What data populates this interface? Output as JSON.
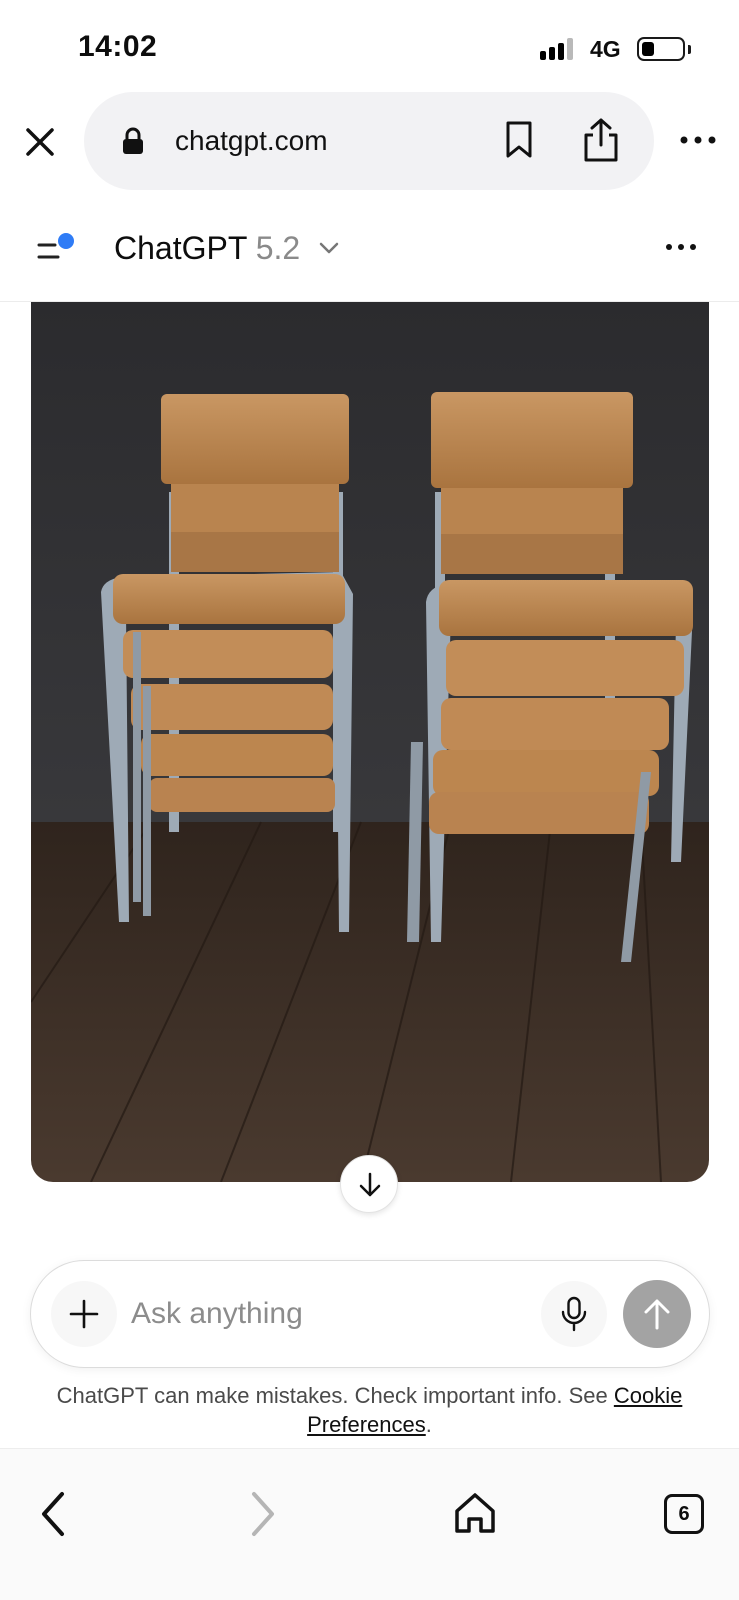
{
  "status_bar": {
    "time": "14:02",
    "network": "4G"
  },
  "browser": {
    "url": "chatgpt.com"
  },
  "header": {
    "app_name": "ChatGPT",
    "model_version": "5.2"
  },
  "image": {
    "subject": "stacked-wooden-school-chairs"
  },
  "composer": {
    "placeholder": "Ask anything"
  },
  "disclaimer": {
    "text": "ChatGPT can make mistakes. Check important info. See ",
    "link_line1": "Cookie",
    "link_line2": "Preferences",
    "suffix": "."
  },
  "bottom_nav": {
    "tab_count": "6"
  },
  "colors": {
    "send_button": "#a3a3a3",
    "status_dot": "#2f7cf6",
    "wall": "#2e2e31",
    "floor": "#3e2f26",
    "wood": "#c08a4f",
    "frame": "#9eaab6"
  }
}
